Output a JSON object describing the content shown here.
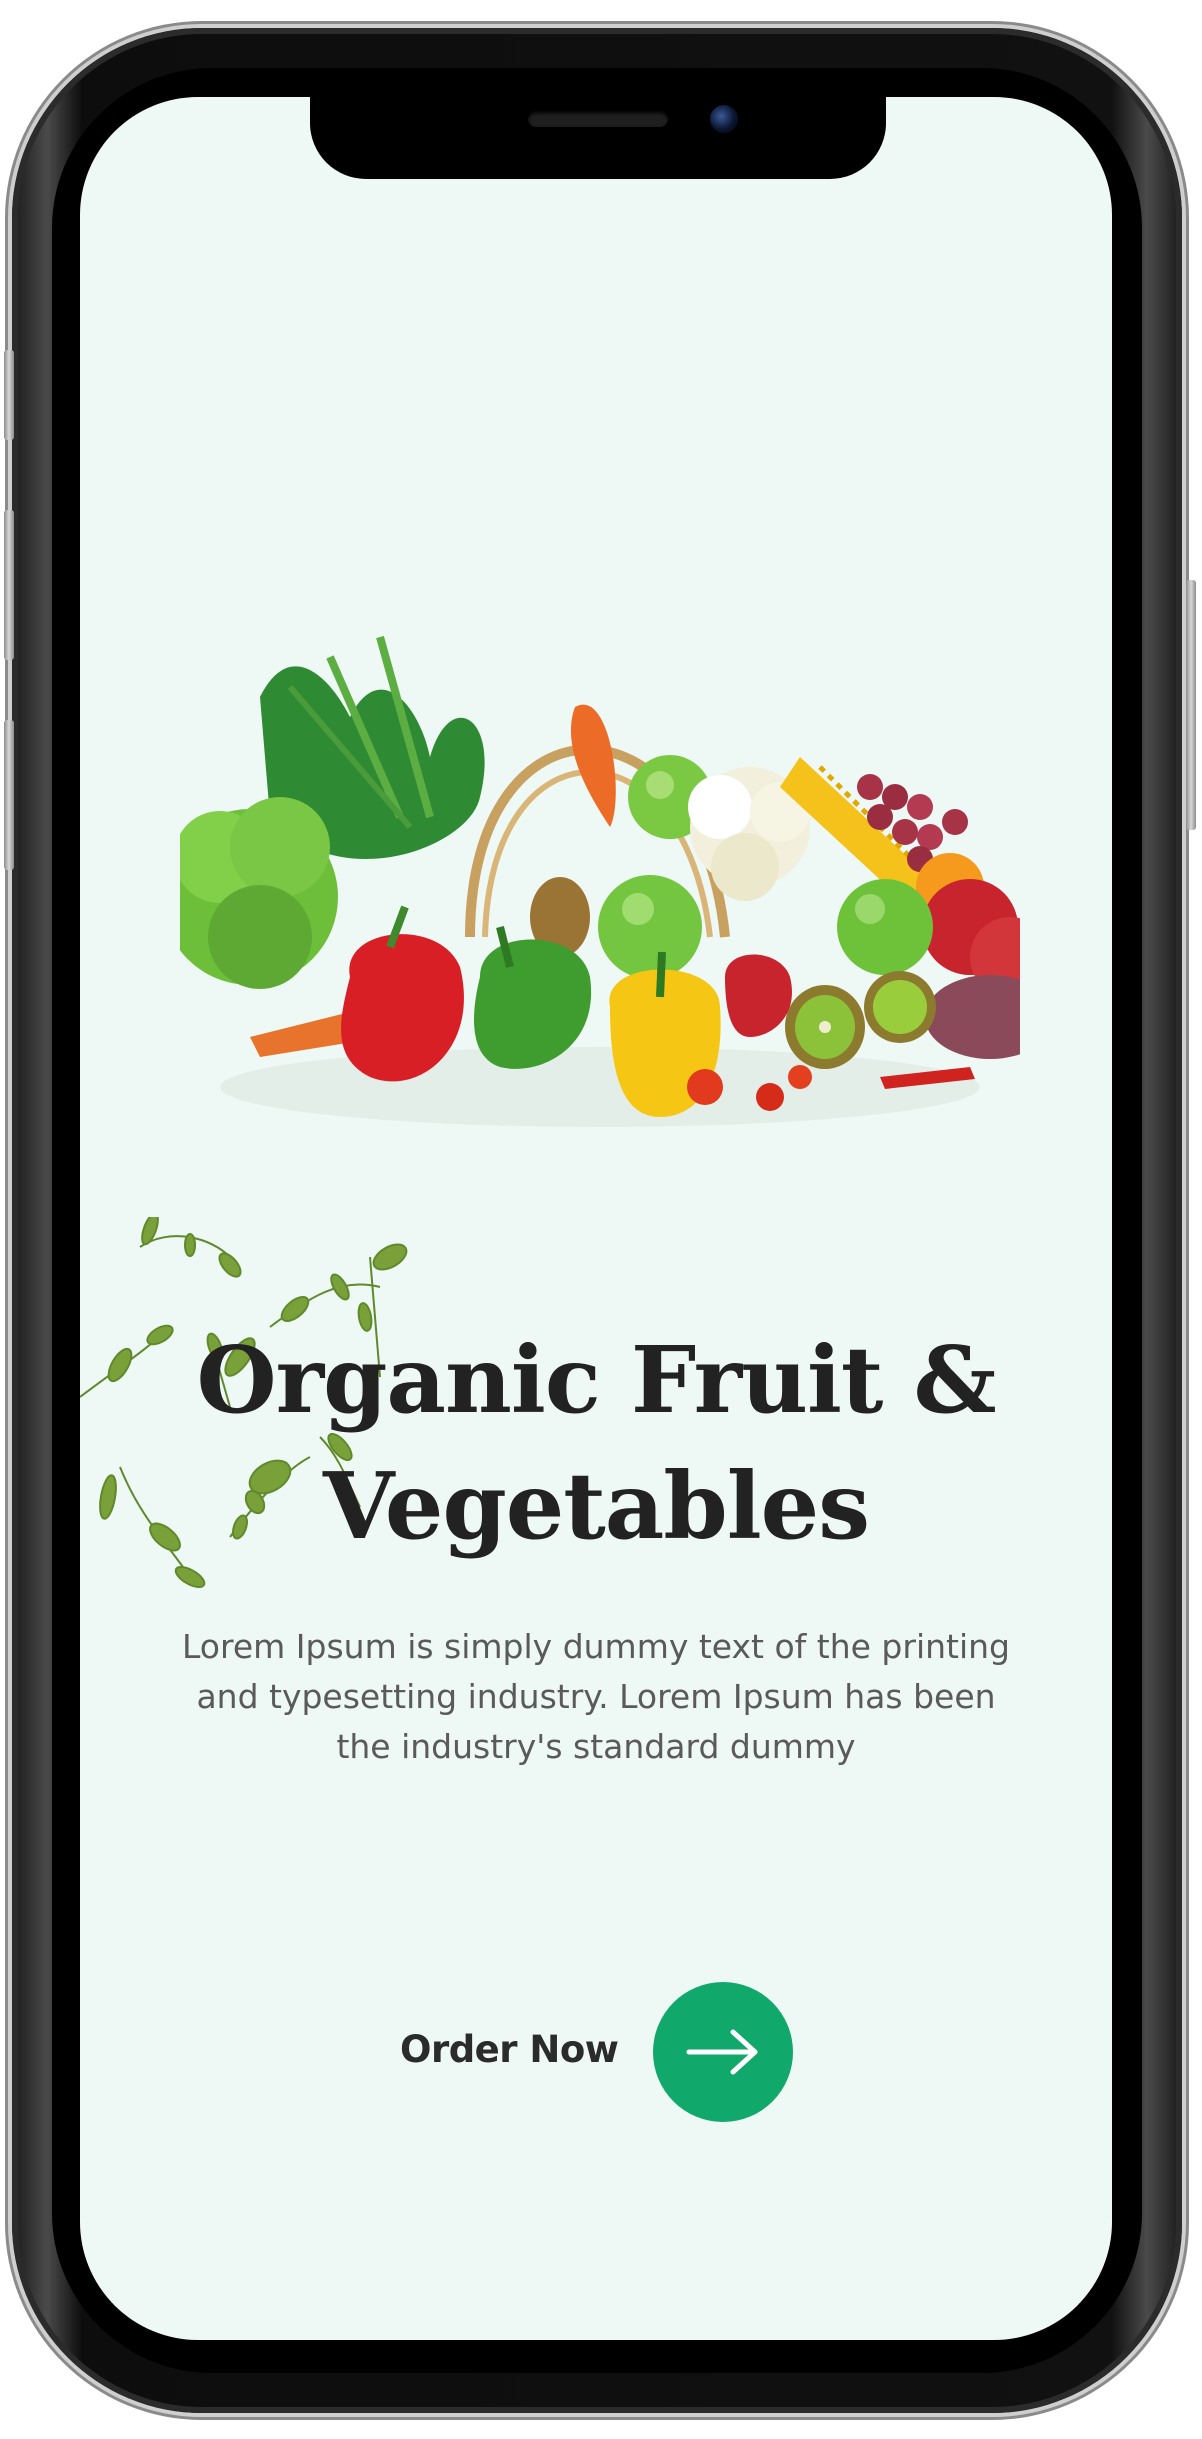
{
  "hero": {
    "title_line1": "Organic Fruit &",
    "title_line2": "Vegetables",
    "description": "Lorem Ipsum is simply dummy text of the printing and typesetting industry. Lorem Ipsum has been the industry's standard dummy"
  },
  "cta": {
    "label": "Order Now",
    "icon": "arrow-right-icon"
  },
  "images": {
    "produce": "vegetable-basket-image",
    "decoration": "leaves-decoration"
  },
  "colors": {
    "screen_background": "#eef8f5",
    "accent_green": "#11a86b",
    "title_text": "#222222",
    "body_text": "#5a5a5a"
  }
}
